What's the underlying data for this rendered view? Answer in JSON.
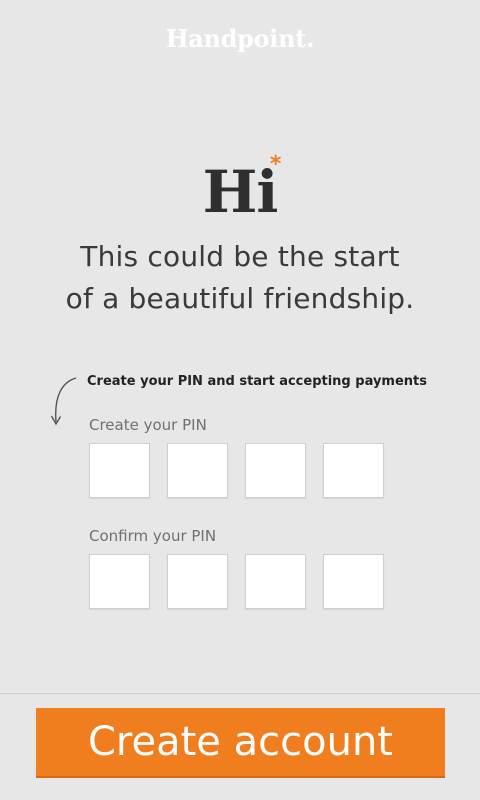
{
  "header": {
    "logo_text": "Handpoint",
    "logo_dot": "."
  },
  "hero": {
    "greeting": "Hi",
    "greeting_star": "*",
    "tagline_line1": "This could be the start",
    "tagline_line2": "of a beautiful friendship."
  },
  "form": {
    "instruction": "Create your PIN and start accepting payments",
    "create_pin_label": "Create your PIN",
    "confirm_pin_label": "Confirm your PIN",
    "create_pin_digits": [
      "",
      "",
      "",
      ""
    ],
    "confirm_pin_digits": [
      "",
      "",
      "",
      ""
    ]
  },
  "footer": {
    "create_button_label": "Create account"
  },
  "colors": {
    "accent": "#f07d1e",
    "background": "#e7e7e7",
    "logo": "#ffffff",
    "heading": "#2f2f2f"
  },
  "icons": {
    "instruction_arrow": "curved-arrow-down-icon"
  }
}
